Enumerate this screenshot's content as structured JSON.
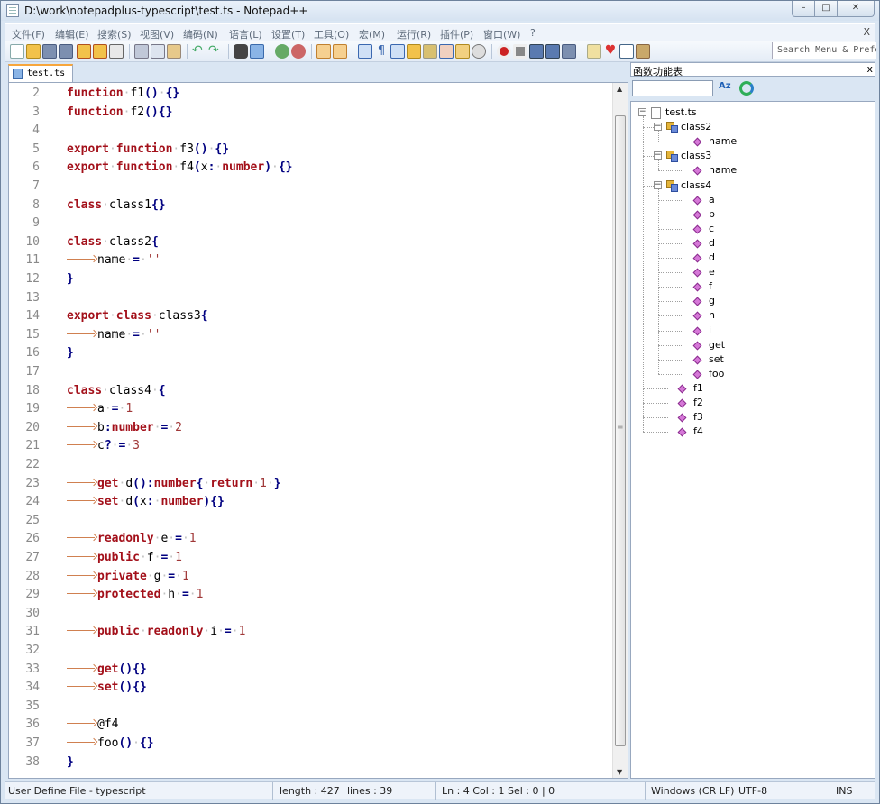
{
  "window": {
    "title": "D:\\work\\notepadplus-typescript\\test.ts - Notepad++",
    "min_glyph": "–",
    "max_glyph": "□",
    "close_glyph": "✕"
  },
  "menu": {
    "items": [
      "文件(F)",
      "编辑(E)",
      "搜索(S)",
      "视图(V)",
      "编码(N)",
      "语言(L)",
      "设置(T)",
      "工具(O)",
      "宏(M)",
      "运行(R)",
      "插件(P)",
      "窗口(W)",
      "?"
    ],
    "close_glyph": "X"
  },
  "toolbar": {
    "search_text": "Search Menu & Prefer",
    "icons": [
      "new-file-icon",
      "open-file-icon",
      "save-icon",
      "save-all-icon",
      "close-icon",
      "close-all-icon",
      "print-icon",
      "cut-icon",
      "copy-icon",
      "paste-icon",
      "undo-icon",
      "redo-icon",
      "find-icon",
      "replace-icon",
      "zoom-in-icon",
      "zoom-out-icon",
      "sync-vertical-icon",
      "sync-horizontal-icon",
      "word-wrap-icon",
      "show-all-chars-icon",
      "indent-guide-icon",
      "user-language-icon",
      "doc-map-icon",
      "function-list-icon",
      "folder-workspace-icon",
      "monitoring-icon",
      "record-macro-icon",
      "stop-record-icon",
      "play-macro-icon",
      "run-macro-multiple-icon",
      "save-macro-icon",
      "spell-check-icon",
      "heart-icon",
      "window-icon",
      "plugin-icon"
    ]
  },
  "tab": {
    "label": "test.ts"
  },
  "editor": {
    "lines": [
      {
        "n": "2",
        "tokens": [
          [
            "kw",
            "function"
          ],
          [
            "ws",
            "·"
          ],
          [
            "t",
            "f1"
          ],
          [
            "op",
            "()"
          ],
          [
            "ws",
            "·"
          ],
          [
            "op",
            "{}"
          ]
        ]
      },
      {
        "n": "3",
        "tokens": [
          [
            "kw",
            "function"
          ],
          [
            "ws",
            "·"
          ],
          [
            "t",
            "f2"
          ],
          [
            "op",
            "(){}"
          ]
        ]
      },
      {
        "n": "4",
        "tokens": []
      },
      {
        "n": "5",
        "tokens": [
          [
            "kw",
            "export"
          ],
          [
            "ws",
            "·"
          ],
          [
            "kw",
            "function"
          ],
          [
            "ws",
            "·"
          ],
          [
            "t",
            "f3"
          ],
          [
            "op",
            "()"
          ],
          [
            "ws",
            "·"
          ],
          [
            "op",
            "{}"
          ]
        ]
      },
      {
        "n": "6",
        "tokens": [
          [
            "kw",
            "export"
          ],
          [
            "ws",
            "·"
          ],
          [
            "kw",
            "function"
          ],
          [
            "ws",
            "·"
          ],
          [
            "t",
            "f4"
          ],
          [
            "op",
            "("
          ],
          [
            "t",
            "x"
          ],
          [
            "op",
            ":"
          ],
          [
            "ws",
            "·"
          ],
          [
            "kw",
            "number"
          ],
          [
            "op",
            ")"
          ],
          [
            "ws",
            "·"
          ],
          [
            "op",
            "{}"
          ]
        ]
      },
      {
        "n": "7",
        "tokens": []
      },
      {
        "n": "8",
        "tokens": [
          [
            "kw",
            "class"
          ],
          [
            "ws",
            "·"
          ],
          [
            "t",
            "class1"
          ],
          [
            "op",
            "{}"
          ]
        ]
      },
      {
        "n": "9",
        "tokens": []
      },
      {
        "n": "10",
        "tokens": [
          [
            "kw",
            "class"
          ],
          [
            "ws",
            "·"
          ],
          [
            "t",
            "class2"
          ],
          [
            "op",
            "{"
          ]
        ]
      },
      {
        "n": "11",
        "tokens": [
          [
            "tab",
            ""
          ],
          [
            "t",
            "name"
          ],
          [
            "ws",
            "·"
          ],
          [
            "op",
            "="
          ],
          [
            "ws",
            "·"
          ],
          [
            "num",
            "''"
          ]
        ]
      },
      {
        "n": "12",
        "tokens": [
          [
            "op",
            "}"
          ]
        ]
      },
      {
        "n": "13",
        "tokens": []
      },
      {
        "n": "14",
        "tokens": [
          [
            "kw",
            "export"
          ],
          [
            "ws",
            "·"
          ],
          [
            "kw",
            "class"
          ],
          [
            "ws",
            "·"
          ],
          [
            "t",
            "class3"
          ],
          [
            "op",
            "{"
          ]
        ]
      },
      {
        "n": "15",
        "tokens": [
          [
            "tab",
            ""
          ],
          [
            "t",
            "name"
          ],
          [
            "ws",
            "·"
          ],
          [
            "op",
            "="
          ],
          [
            "ws",
            "·"
          ],
          [
            "num",
            "''"
          ]
        ]
      },
      {
        "n": "16",
        "tokens": [
          [
            "op",
            "}"
          ]
        ]
      },
      {
        "n": "17",
        "tokens": []
      },
      {
        "n": "18",
        "tokens": [
          [
            "kw",
            "class"
          ],
          [
            "ws",
            "·"
          ],
          [
            "t",
            "class4"
          ],
          [
            "ws",
            "·"
          ],
          [
            "op",
            "{"
          ]
        ]
      },
      {
        "n": "19",
        "tokens": [
          [
            "tab",
            ""
          ],
          [
            "t",
            "a"
          ],
          [
            "ws",
            "·"
          ],
          [
            "op",
            "="
          ],
          [
            "ws",
            "·"
          ],
          [
            "num",
            "1"
          ]
        ]
      },
      {
        "n": "20",
        "tokens": [
          [
            "tab",
            ""
          ],
          [
            "t",
            "b"
          ],
          [
            "op",
            ":"
          ],
          [
            "kw",
            "number"
          ],
          [
            "ws",
            "·"
          ],
          [
            "op",
            "="
          ],
          [
            "ws",
            "·"
          ],
          [
            "num",
            "2"
          ]
        ]
      },
      {
        "n": "21",
        "tokens": [
          [
            "tab",
            ""
          ],
          [
            "t",
            "c"
          ],
          [
            "op",
            "?"
          ],
          [
            "ws",
            "·"
          ],
          [
            "op",
            "="
          ],
          [
            "ws",
            "·"
          ],
          [
            "num",
            "3"
          ]
        ]
      },
      {
        "n": "22",
        "tokens": []
      },
      {
        "n": "23",
        "tokens": [
          [
            "tab",
            ""
          ],
          [
            "kw",
            "get"
          ],
          [
            "ws",
            "·"
          ],
          [
            "t",
            "d"
          ],
          [
            "op",
            "():"
          ],
          [
            "kw",
            "number"
          ],
          [
            "op",
            "{"
          ],
          [
            "ws",
            "·"
          ],
          [
            "kw",
            "return"
          ],
          [
            "ws",
            "·"
          ],
          [
            "num",
            "1"
          ],
          [
            "ws",
            "·"
          ],
          [
            "op",
            "}"
          ]
        ]
      },
      {
        "n": "24",
        "tokens": [
          [
            "tab",
            ""
          ],
          [
            "kw",
            "set"
          ],
          [
            "ws",
            "·"
          ],
          [
            "t",
            "d"
          ],
          [
            "op",
            "("
          ],
          [
            "t",
            "x"
          ],
          [
            "op",
            ":"
          ],
          [
            "ws",
            "·"
          ],
          [
            "kw",
            "number"
          ],
          [
            "op",
            "){}"
          ]
        ]
      },
      {
        "n": "25",
        "tokens": []
      },
      {
        "n": "26",
        "tokens": [
          [
            "tab",
            ""
          ],
          [
            "kw",
            "readonly"
          ],
          [
            "ws",
            "·"
          ],
          [
            "t",
            "e"
          ],
          [
            "ws",
            "·"
          ],
          [
            "op",
            "="
          ],
          [
            "ws",
            "·"
          ],
          [
            "num",
            "1"
          ]
        ]
      },
      {
        "n": "27",
        "tokens": [
          [
            "tab",
            ""
          ],
          [
            "kw",
            "public"
          ],
          [
            "ws",
            "·"
          ],
          [
            "t",
            "f"
          ],
          [
            "ws",
            "·"
          ],
          [
            "op",
            "="
          ],
          [
            "ws",
            "·"
          ],
          [
            "num",
            "1"
          ]
        ]
      },
      {
        "n": "28",
        "tokens": [
          [
            "tab",
            ""
          ],
          [
            "kw",
            "private"
          ],
          [
            "ws",
            "·"
          ],
          [
            "t",
            "g"
          ],
          [
            "ws",
            "·"
          ],
          [
            "op",
            "="
          ],
          [
            "ws",
            "·"
          ],
          [
            "num",
            "1"
          ]
        ]
      },
      {
        "n": "29",
        "tokens": [
          [
            "tab",
            ""
          ],
          [
            "kw",
            "protected"
          ],
          [
            "ws",
            "·"
          ],
          [
            "t",
            "h"
          ],
          [
            "ws",
            "·"
          ],
          [
            "op",
            "="
          ],
          [
            "ws",
            "·"
          ],
          [
            "num",
            "1"
          ]
        ]
      },
      {
        "n": "30",
        "tokens": []
      },
      {
        "n": "31",
        "tokens": [
          [
            "tab",
            ""
          ],
          [
            "kw",
            "public"
          ],
          [
            "ws",
            "·"
          ],
          [
            "kw",
            "readonly"
          ],
          [
            "ws",
            "·"
          ],
          [
            "t",
            "i"
          ],
          [
            "ws",
            "·"
          ],
          [
            "op",
            "="
          ],
          [
            "ws",
            "·"
          ],
          [
            "num",
            "1"
          ]
        ]
      },
      {
        "n": "32",
        "tokens": []
      },
      {
        "n": "33",
        "tokens": [
          [
            "tab",
            ""
          ],
          [
            "kw",
            "get"
          ],
          [
            "op",
            "(){}"
          ]
        ]
      },
      {
        "n": "34",
        "tokens": [
          [
            "tab",
            ""
          ],
          [
            "kw",
            "set"
          ],
          [
            "op",
            "(){}"
          ]
        ]
      },
      {
        "n": "35",
        "tokens": []
      },
      {
        "n": "36",
        "tokens": [
          [
            "tab",
            ""
          ],
          [
            "t",
            "@f4"
          ]
        ]
      },
      {
        "n": "37",
        "tokens": [
          [
            "tab",
            ""
          ],
          [
            "t",
            "foo"
          ],
          [
            "op",
            "()"
          ],
          [
            "ws",
            "·"
          ],
          [
            "op",
            "{}"
          ]
        ]
      },
      {
        "n": "38",
        "tokens": [
          [
            "op",
            "}"
          ]
        ]
      }
    ],
    "colors": {
      "keyword": "#a3101a",
      "operator": "#000080",
      "number": "#a03838",
      "linenumber": "#8a8a8a"
    }
  },
  "function_list": {
    "title": "函数功能表",
    "close_glyph": "x",
    "search_value": "",
    "sort_label": "Az",
    "tree": [
      {
        "label": "test.ts",
        "type": "file",
        "depth": 0,
        "expander": "−"
      },
      {
        "label": "class2",
        "type": "class",
        "depth": 1,
        "expander": "−"
      },
      {
        "label": "name",
        "type": "fn",
        "depth": 2
      },
      {
        "label": "class3",
        "type": "class",
        "depth": 1,
        "expander": "−"
      },
      {
        "label": "name",
        "type": "fn",
        "depth": 2
      },
      {
        "label": "class4",
        "type": "class",
        "depth": 1,
        "expander": "−"
      },
      {
        "label": "a",
        "type": "fn",
        "depth": 2
      },
      {
        "label": "b",
        "type": "fn",
        "depth": 2
      },
      {
        "label": "c",
        "type": "fn",
        "depth": 2
      },
      {
        "label": "d",
        "type": "fn",
        "depth": 2
      },
      {
        "label": "d",
        "type": "fn",
        "depth": 2
      },
      {
        "label": "e",
        "type": "fn",
        "depth": 2
      },
      {
        "label": "f",
        "type": "fn",
        "depth": 2
      },
      {
        "label": "g",
        "type": "fn",
        "depth": 2
      },
      {
        "label": "h",
        "type": "fn",
        "depth": 2
      },
      {
        "label": "i",
        "type": "fn",
        "depth": 2
      },
      {
        "label": "get",
        "type": "fn",
        "depth": 2
      },
      {
        "label": "set",
        "type": "fn",
        "depth": 2
      },
      {
        "label": "foo",
        "type": "fn",
        "depth": 2
      },
      {
        "label": "f1",
        "type": "fn",
        "depth": 1
      },
      {
        "label": "f2",
        "type": "fn",
        "depth": 1
      },
      {
        "label": "f3",
        "type": "fn",
        "depth": 1
      },
      {
        "label": "f4",
        "type": "fn",
        "depth": 1
      }
    ]
  },
  "statusbar": {
    "lang": "User Define File - typescript",
    "length": "length : 427",
    "lines": "lines : 39",
    "position": "Ln : 4    Col : 1    Sel : 0 | 0",
    "eol": "Windows (CR LF)",
    "encoding": "UTF-8",
    "mode": "INS"
  }
}
